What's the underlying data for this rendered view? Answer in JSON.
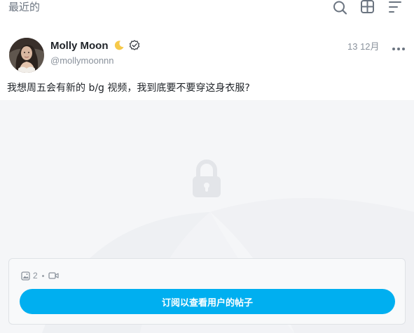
{
  "topbar": {
    "title": "最近的",
    "icons": [
      "search-icon",
      "grid-icon",
      "sort-icon"
    ]
  },
  "post": {
    "author": {
      "display_name": "Molly Moon",
      "handle": "@mollymoonnn",
      "badges": [
        "moon-icon",
        "verified-icon"
      ]
    },
    "date": "13 12月",
    "text": "我想周五会有新的 b/g 视频，我到底要不要穿这身衣服?",
    "media": {
      "locked": true,
      "image_count": "2",
      "has_video": true
    },
    "unlock_button_label": "订阅以查看用户的帖子"
  },
  "colors": {
    "accent": "#00aff0",
    "muted_text": "#8a929c",
    "media_background": "#f5f6f8"
  }
}
